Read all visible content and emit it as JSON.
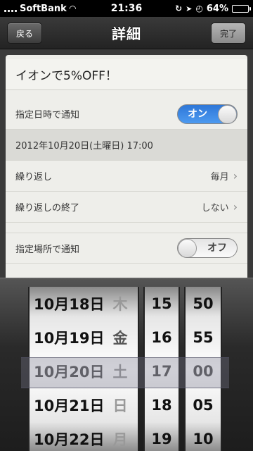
{
  "status_bar": {
    "carrier": "SoftBank",
    "time": "21:36",
    "battery": "64%",
    "battery_level": 0.64
  },
  "nav": {
    "back_label": "戻る",
    "title": "詳細",
    "done_label": "完了"
  },
  "reminder": {
    "title": "イオンで5%OFF！",
    "date_notify_label": "指定日時で通知",
    "date_notify_toggle": "オン",
    "datetime": "2012年10月20日(土曜日) 17:00",
    "repeat_label": "繰り返し",
    "repeat_value": "毎月",
    "repeat_end_label": "繰り返しの終了",
    "repeat_end_value": "しない",
    "location_notify_label": "指定場所で通知",
    "location_notify_toggle": "オフ"
  },
  "picker": {
    "dates": [
      {
        "date": "10月18日",
        "dow": "木"
      },
      {
        "date": "10月19日",
        "dow": "金"
      },
      {
        "date": "10月20日",
        "dow": "土"
      },
      {
        "date": "10月21日",
        "dow": "日"
      },
      {
        "date": "10月22日",
        "dow": "月"
      }
    ],
    "hours": [
      "15",
      "16",
      "17",
      "18",
      "19"
    ],
    "minutes": [
      "50",
      "55",
      "00",
      "05",
      "10"
    ],
    "selected_index": 2
  },
  "colors": {
    "toggle_on": "#2e77d8",
    "nav_bar": "#2c2c2c",
    "panel": "#eeeeea"
  }
}
